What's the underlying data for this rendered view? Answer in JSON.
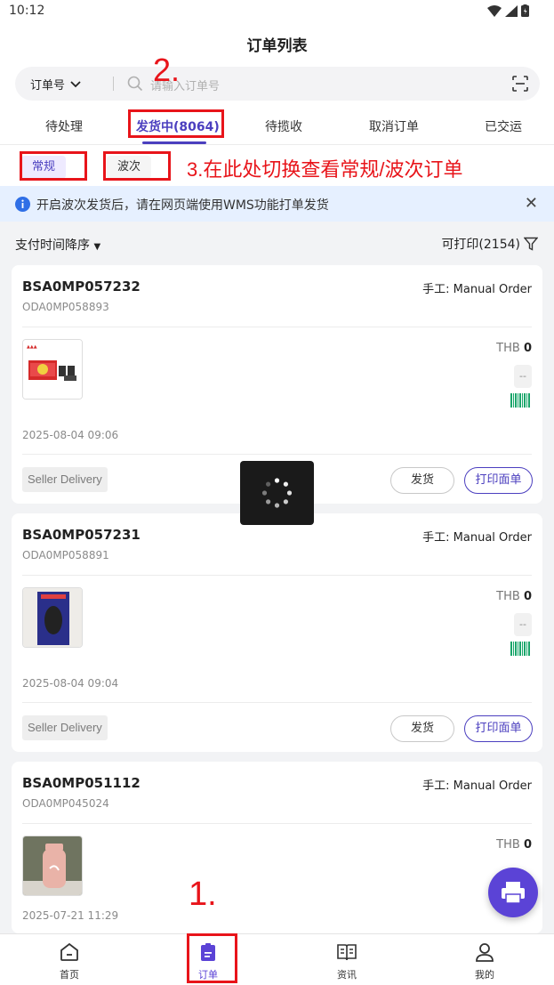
{
  "status_bar": {
    "time": "10:12"
  },
  "header": {
    "title": "订单列表",
    "search": {
      "filter_label": "订单号",
      "placeholder": "请输入订单号"
    },
    "tabs": [
      {
        "label": "待处理"
      },
      {
        "label": "发货中(8064)"
      },
      {
        "label": "待揽收"
      },
      {
        "label": "取消订单"
      },
      {
        "label": "已交运"
      }
    ]
  },
  "subtabs": {
    "normal_label": "常规",
    "wave_label": "波次"
  },
  "notice": {
    "text": "开启波次发货后，请在网页端使用WMS功能打单发货"
  },
  "sort_bar": {
    "sort_label": "支付时间降序",
    "printable_label": "可打印(2154)"
  },
  "orders": [
    {
      "order_no": "BSA0MP057232",
      "sub_no": "ODA0MP058893",
      "source": "手工: Manual Order",
      "currency": "THB",
      "amount": "0",
      "dash": "--",
      "date": "2025-08-04 09:06",
      "tag": "Seller Delivery",
      "ship_label": "发货",
      "print_label": "打印面单",
      "thumb_icon": "red-gift-box-product-image"
    },
    {
      "order_no": "BSA0MP057231",
      "sub_no": "ODA0MP058891",
      "source": "手工: Manual Order",
      "currency": "THB",
      "amount": "0",
      "dash": "--",
      "date": "2025-08-04 09:04",
      "tag": "Seller Delivery",
      "ship_label": "发货",
      "print_label": "打印面单",
      "thumb_icon": "computer-mouse-box-product-image"
    },
    {
      "order_no": "BSA0MP051112",
      "sub_no": "ODA0MP045024",
      "source": "手工: Manual Order",
      "currency": "THB",
      "amount": "0",
      "date": "2025-07-21 11:29",
      "thumb_icon": "pink-bottle-product-image"
    }
  ],
  "annotations": {
    "step1": "1.",
    "step2": "2.",
    "step3": "3.在此处切换查看常规/波次订单",
    "color": "#e8141a"
  },
  "bottom_nav": [
    {
      "label": "首页",
      "icon": "home-icon"
    },
    {
      "label": "订单",
      "icon": "orders-icon"
    },
    {
      "label": "资讯",
      "icon": "book-icon"
    },
    {
      "label": "我的",
      "icon": "user-icon"
    }
  ],
  "colors": {
    "accent": "#4b3fbf",
    "fab": "#5b43d6",
    "notice_bg": "#e6f0ff"
  }
}
